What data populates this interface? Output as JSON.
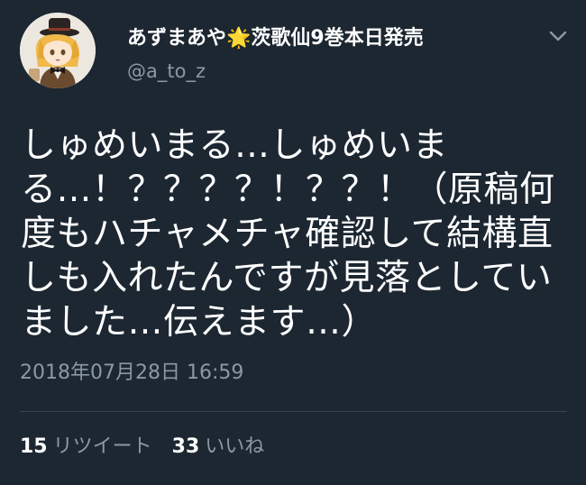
{
  "tweet": {
    "author": {
      "name_part1": "あずまあや",
      "star": "🌟",
      "name_part2": "茨歌仙9巻本日発売",
      "handle": "@a_to_z",
      "avatar_icon": "avatar-illustration"
    },
    "text": "しゅめいまる…しゅめいまる…！？？？？！？？！（原稿何度もハチャメチャ確認して結構直しも入れたんですが見落としていました…伝えます…）",
    "timestamp": "2018年07月28日 16:59",
    "stats": {
      "retweets_count": "15",
      "retweets_label": "リツイート",
      "likes_count": "33",
      "likes_label": "いいね"
    },
    "menu_icon": "chevron-down-icon"
  },
  "colors": {
    "background": "#1c2732",
    "text_primary": "#ffffff",
    "text_secondary": "#8b98a5",
    "divider": "#38444d"
  }
}
